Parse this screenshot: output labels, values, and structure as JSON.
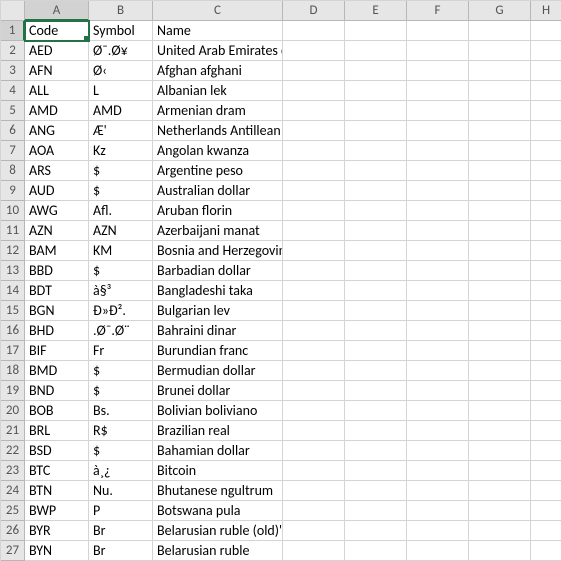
{
  "columns": [
    "A",
    "B",
    "C",
    "D",
    "E",
    "F",
    "G",
    "H"
  ],
  "active_cell": {
    "row": 1,
    "col": "A"
  },
  "rows": [
    {
      "n": 1,
      "A": "Code",
      "B": "Symbol",
      "C": "Name"
    },
    {
      "n": 2,
      "A": "AED",
      "B": "Ø¯.Ø¥",
      "C": "United Arab Emirates d"
    },
    {
      "n": 3,
      "A": "AFN",
      "B": "Ø‹",
      "C": "Afghan afghani"
    },
    {
      "n": 4,
      "A": "ALL",
      "B": "L",
      "C": "Albanian lek"
    },
    {
      "n": 5,
      "A": "AMD",
      "B": "AMD",
      "C": "Armenian dram"
    },
    {
      "n": 6,
      "A": "ANG",
      "B": "Æ'",
      "C": "Netherlands Antillean gu"
    },
    {
      "n": 7,
      "A": "AOA",
      "B": "Kz",
      "C": "Angolan kwanza"
    },
    {
      "n": 8,
      "A": "ARS",
      "B": "$",
      "C": "Argentine peso"
    },
    {
      "n": 9,
      "A": "AUD",
      "B": "$",
      "C": "Australian dollar"
    },
    {
      "n": 10,
      "A": "AWG",
      "B": "Afl.",
      "C": "Aruban florin"
    },
    {
      "n": 11,
      "A": "AZN",
      "B": "AZN",
      "C": "Azerbaijani manat"
    },
    {
      "n": 12,
      "A": "BAM",
      "B": "KM",
      "C": "Bosnia and Herzegovina"
    },
    {
      "n": 13,
      "A": "BBD",
      "B": "$",
      "C": "Barbadian dollar"
    },
    {
      "n": 14,
      "A": "BDT",
      "B": "à§³",
      "C": "Bangladeshi taka"
    },
    {
      "n": 15,
      "A": "BGN",
      "B": "Ð»Ð².",
      "C": "Bulgarian lev"
    },
    {
      "n": 16,
      "A": "BHD",
      "B": ".Ø¯.Ø¨",
      "C": "Bahraini dinar"
    },
    {
      "n": 17,
      "A": "BIF",
      "B": "Fr",
      "C": "Burundian franc"
    },
    {
      "n": 18,
      "A": "BMD",
      "B": "$",
      "C": "Bermudian dollar"
    },
    {
      "n": 19,
      "A": "BND",
      "B": "$",
      "C": "Brunei dollar"
    },
    {
      "n": 20,
      "A": "BOB",
      "B": "Bs.",
      "C": "Bolivian boliviano"
    },
    {
      "n": 21,
      "A": "BRL",
      "B": "R$",
      "C": "Brazilian real"
    },
    {
      "n": 22,
      "A": "BSD",
      "B": "$",
      "C": "Bahamian dollar"
    },
    {
      "n": 23,
      "A": "BTC",
      "B": "à¸¿",
      "C": "Bitcoin"
    },
    {
      "n": 24,
      "A": "BTN",
      "B": "Nu.",
      "C": "Bhutanese ngultrum"
    },
    {
      "n": 25,
      "A": "BWP",
      "B": "P",
      "C": "Botswana pula"
    },
    {
      "n": 26,
      "A": "BYR",
      "B": "Br",
      "C": "Belarusian ruble (old)'"
    },
    {
      "n": 27,
      "A": "BYN",
      "B": "Br",
      "C": "Belarusian ruble"
    }
  ]
}
